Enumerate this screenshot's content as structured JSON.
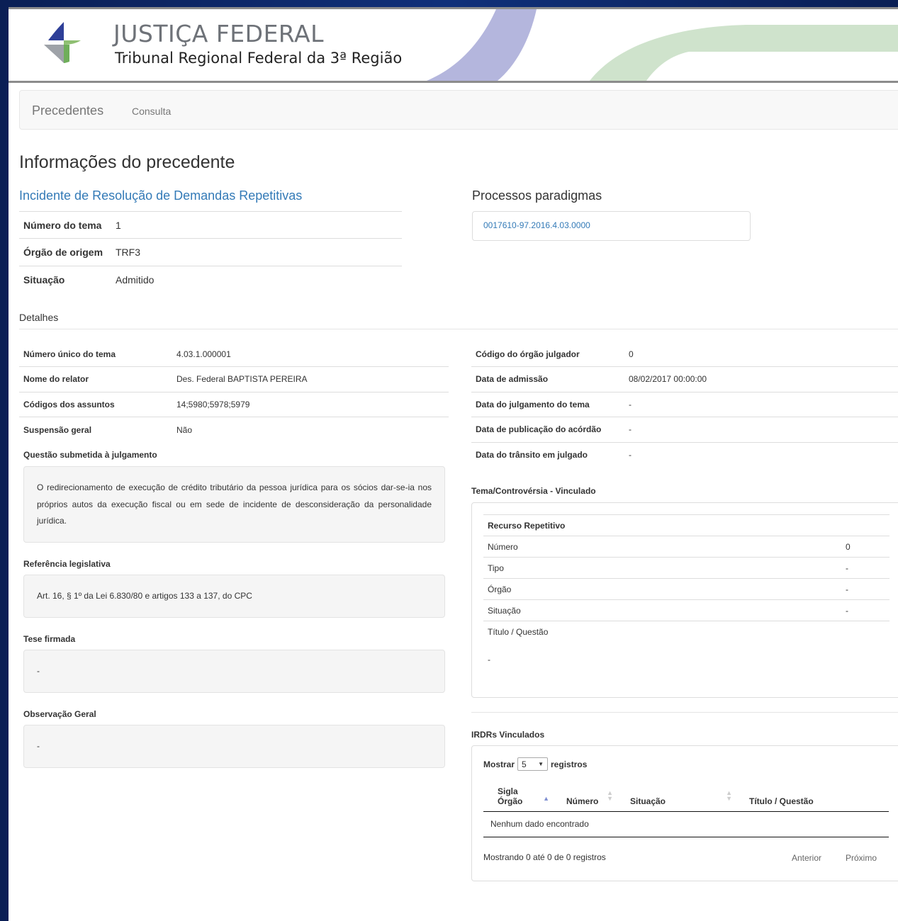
{
  "header": {
    "brand_title": "JUSTIÇA FEDERAL",
    "brand_subtitle": "Tribunal Regional Federal da 3ª Região"
  },
  "navbar": {
    "brand": "Precedentes",
    "link": "Consulta"
  },
  "page_title": "Informações do precedente",
  "precedent_type": "Incidente de Resolução de Demandas Repetitivas",
  "info": {
    "numero_tema_label": "Número do tema",
    "numero_tema": "1",
    "orgao_origem_label": "Órgão de origem",
    "orgao_origem": "TRF3",
    "situacao_label": "Situação",
    "situacao": "Admitido"
  },
  "processos": {
    "title": "Processos paradigmas",
    "items": [
      "0017610-97.2016.4.03.0000"
    ]
  },
  "detalhes_label": "Detalhes",
  "details_left": [
    {
      "label": "Número único do tema",
      "value": "4.03.1.000001"
    },
    {
      "label": "Nome do relator",
      "value": "Des. Federal BAPTISTA PEREIRA"
    },
    {
      "label": "Códigos dos assuntos",
      "value": "14;5980;5978;5979"
    },
    {
      "label": "Suspensão geral",
      "value": "Não"
    }
  ],
  "details_right": [
    {
      "label": "Código do órgão julgador",
      "value": "0"
    },
    {
      "label": "Data de admissão",
      "value": "08/02/2017 00:00:00"
    },
    {
      "label": "Data do julgamento do tema",
      "value": "-"
    },
    {
      "label": "Data de publicação do acórdão",
      "value": "-"
    },
    {
      "label": "Data do trânsito em julgado",
      "value": "-"
    }
  ],
  "questao": {
    "label": "Questão submetida à julgamento",
    "text": "O redirecionamento de execução de crédito tributário da pessoa jurídica para os sócios dar-se-ia nos próprios autos da execução fiscal ou em sede de incidente de desconsideração da personalidade jurídica."
  },
  "referencia": {
    "label": "Referência legislativa",
    "text": "Art. 16, § 1º da Lei 6.830/80 e artigos 133 a 137, do CPC"
  },
  "tese": {
    "label": "Tese firmada",
    "text": "-"
  },
  "observacao": {
    "label": "Observação Geral",
    "text": "-"
  },
  "tema_vinculado": {
    "label": "Tema/Controvérsia - Vinculado",
    "heading": "Recurso Repetitivo",
    "rows": [
      {
        "label": "Número",
        "value": "0"
      },
      {
        "label": "Tipo",
        "value": "-"
      },
      {
        "label": "Órgão",
        "value": "-"
      },
      {
        "label": "Situação",
        "value": "-"
      }
    ],
    "titulo_label": "Título / Questão",
    "titulo_value": "-"
  },
  "irdrs": {
    "label": "IRDRs Vinculados",
    "show_prefix": "Mostrar",
    "page_size": "5",
    "show_suffix": "registros",
    "columns": {
      "sigla_line1": "Sigla",
      "sigla_line2": "Órgão",
      "numero": "Número",
      "situacao": "Situação",
      "titulo": "Título / Questão"
    },
    "empty": "Nenhum dado encontrado",
    "info": "Mostrando 0 até 0 de 0 registros",
    "prev": "Anterior",
    "next": "Próximo"
  }
}
